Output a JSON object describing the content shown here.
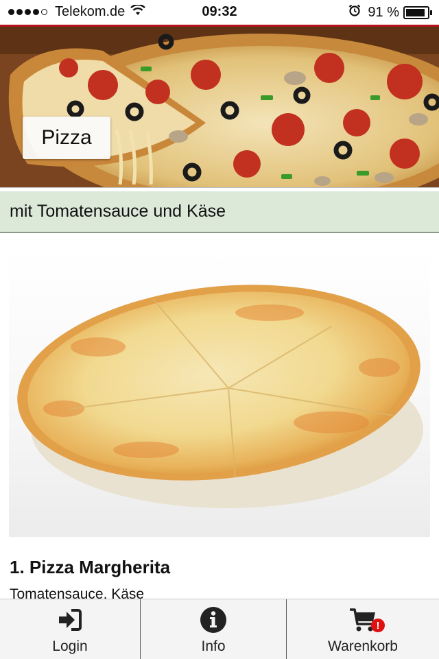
{
  "status_bar": {
    "carrier": "Telekom.de",
    "time": "09:32",
    "battery_percent": "91 %",
    "battery_level": 0.91,
    "signal_bars": 4
  },
  "category": {
    "title": "Pizza",
    "subtitle": "mit Tomatensauce und Käse"
  },
  "product": {
    "title": "1. Pizza Margherita",
    "description": "Tomatensauce, Käse"
  },
  "tab_bar": {
    "items": [
      {
        "label": "Login",
        "icon": "login-icon"
      },
      {
        "label": "Info",
        "icon": "info-icon"
      },
      {
        "label": "Warenkorb",
        "icon": "cart-icon",
        "badge": "!"
      }
    ]
  },
  "colors": {
    "accent_red": "#b5121b",
    "subtitle_bg": "#dce9d9",
    "badge_red": "#e01010"
  }
}
